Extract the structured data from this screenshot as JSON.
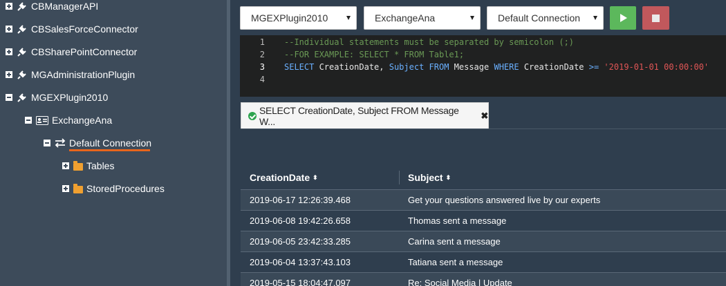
{
  "sidebar": {
    "plugins": [
      {
        "label": "CBManagerAPI"
      },
      {
        "label": "CBSalesForceConnector"
      },
      {
        "label": "CBSharePointConnector"
      },
      {
        "label": "MGAdministrationPlugin"
      },
      {
        "label": "MGEXPlugin2010"
      }
    ],
    "datasource": {
      "label": "ExchangeAna"
    },
    "connection": {
      "label": "Default Connection"
    },
    "folders": [
      {
        "label": "Tables"
      },
      {
        "label": "StoredProcedures"
      }
    ]
  },
  "toolbar": {
    "plugin_select": "MGEXPlugin2010",
    "datasource_select": "ExchangeAna",
    "connection_select": "Default Connection",
    "accent_run": "#5cb85c",
    "accent_stop": "#c1585c"
  },
  "editor": {
    "lines": [
      {
        "num": "1",
        "text": "--Individual statements must be separated by semicolon (;)"
      },
      {
        "num": "2",
        "text": "--FOR EXAMPLE: SELECT * FROM Table1;"
      },
      {
        "num": "3",
        "kw1": "SELECT",
        "id1": " CreationDate, ",
        "kw2": "Subject FROM",
        "id2": " Message ",
        "kw3": "WHERE",
        "id3": " CreationDate ",
        "op": ">=",
        "str": " '2019-01-01 00:00:00'"
      },
      {
        "num": "4",
        "text": ""
      }
    ]
  },
  "result_tab": {
    "label": "SELECT CreationDate, Subject FROM Message W...",
    "close": "✖"
  },
  "table": {
    "columns": [
      "CreationDate",
      "Subject"
    ],
    "sort_glyph": "⬍",
    "rows": [
      {
        "date": "2019-06-17 12:26:39.468",
        "subject": "Get your questions answered live by our experts"
      },
      {
        "date": "2019-06-08 19:42:26.658",
        "subject": "Thomas sent a message"
      },
      {
        "date": "2019-06-05 23:42:33.285",
        "subject": "Carina sent a message"
      },
      {
        "date": "2019-06-04 13:37:43.103",
        "subject": "Tatiana sent a message"
      },
      {
        "date": "2019-05-15 18:04:47.097",
        "subject": "Re: Social Media | Update"
      }
    ]
  }
}
